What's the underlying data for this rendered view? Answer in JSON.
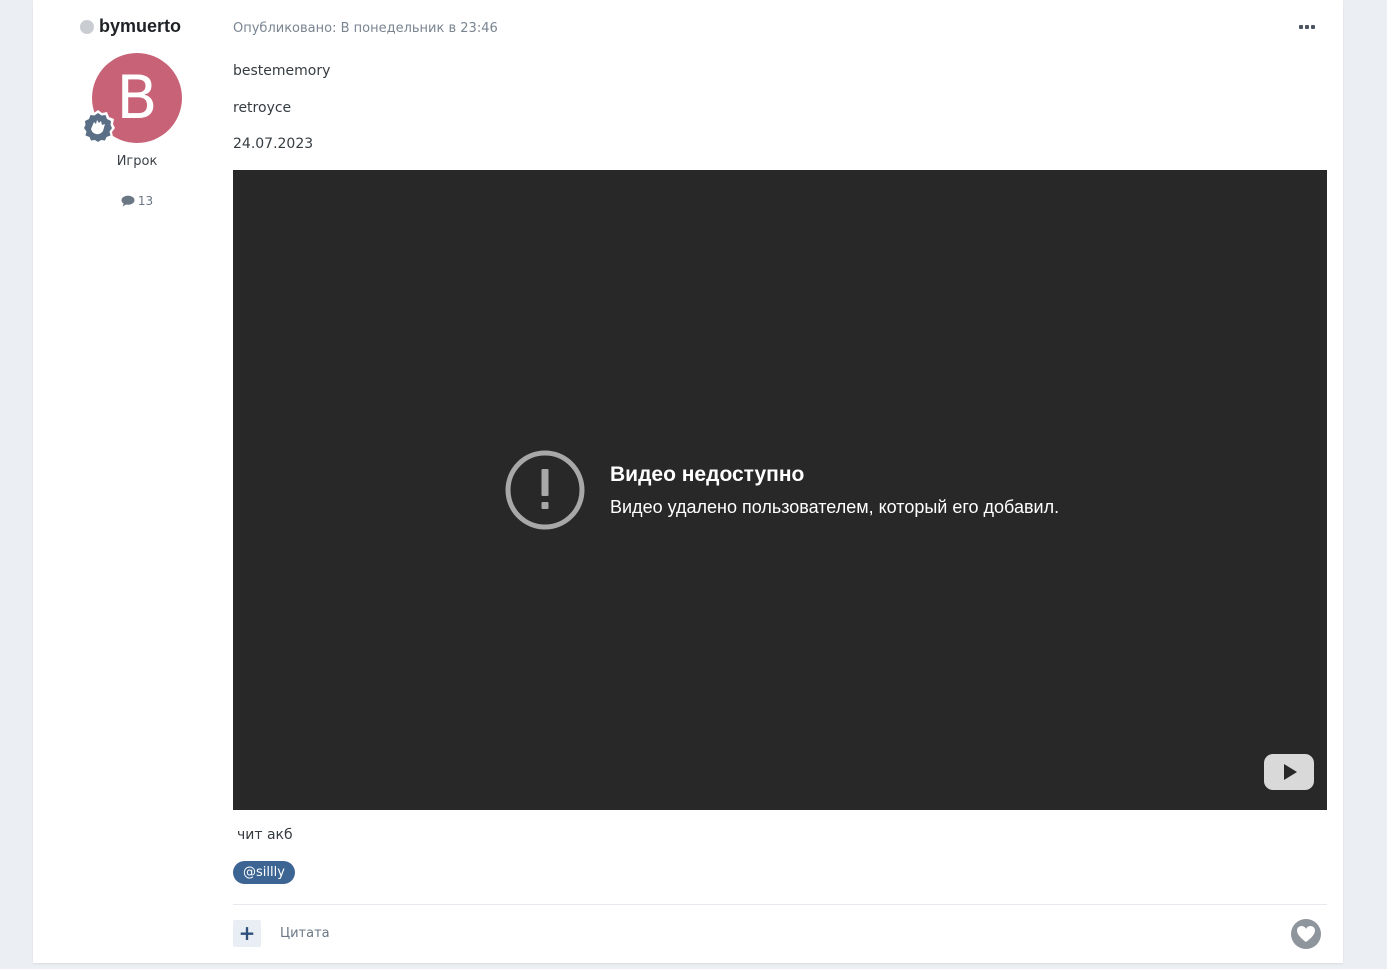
{
  "author": {
    "name": "bymuerto",
    "avatar_letter": "B",
    "avatar_color": "#c86377",
    "group": "Игрок",
    "post_count": "13"
  },
  "post": {
    "meta": "Опубликовано: В понедельник в 23:46",
    "lines": [
      "bestememory",
      "retroyce",
      "24.07.2023"
    ],
    "video": {
      "error_title": "Видео недоступно",
      "error_message": "Видео удалено пользователем, который его добавил."
    },
    "footer_text": "чит акб",
    "mention_tag": "@sillly"
  },
  "actions": {
    "multiquote_label": "+",
    "quote_label": "Цитата"
  },
  "colors": {
    "accent": "#3d6594",
    "video_bg": "#282828"
  }
}
